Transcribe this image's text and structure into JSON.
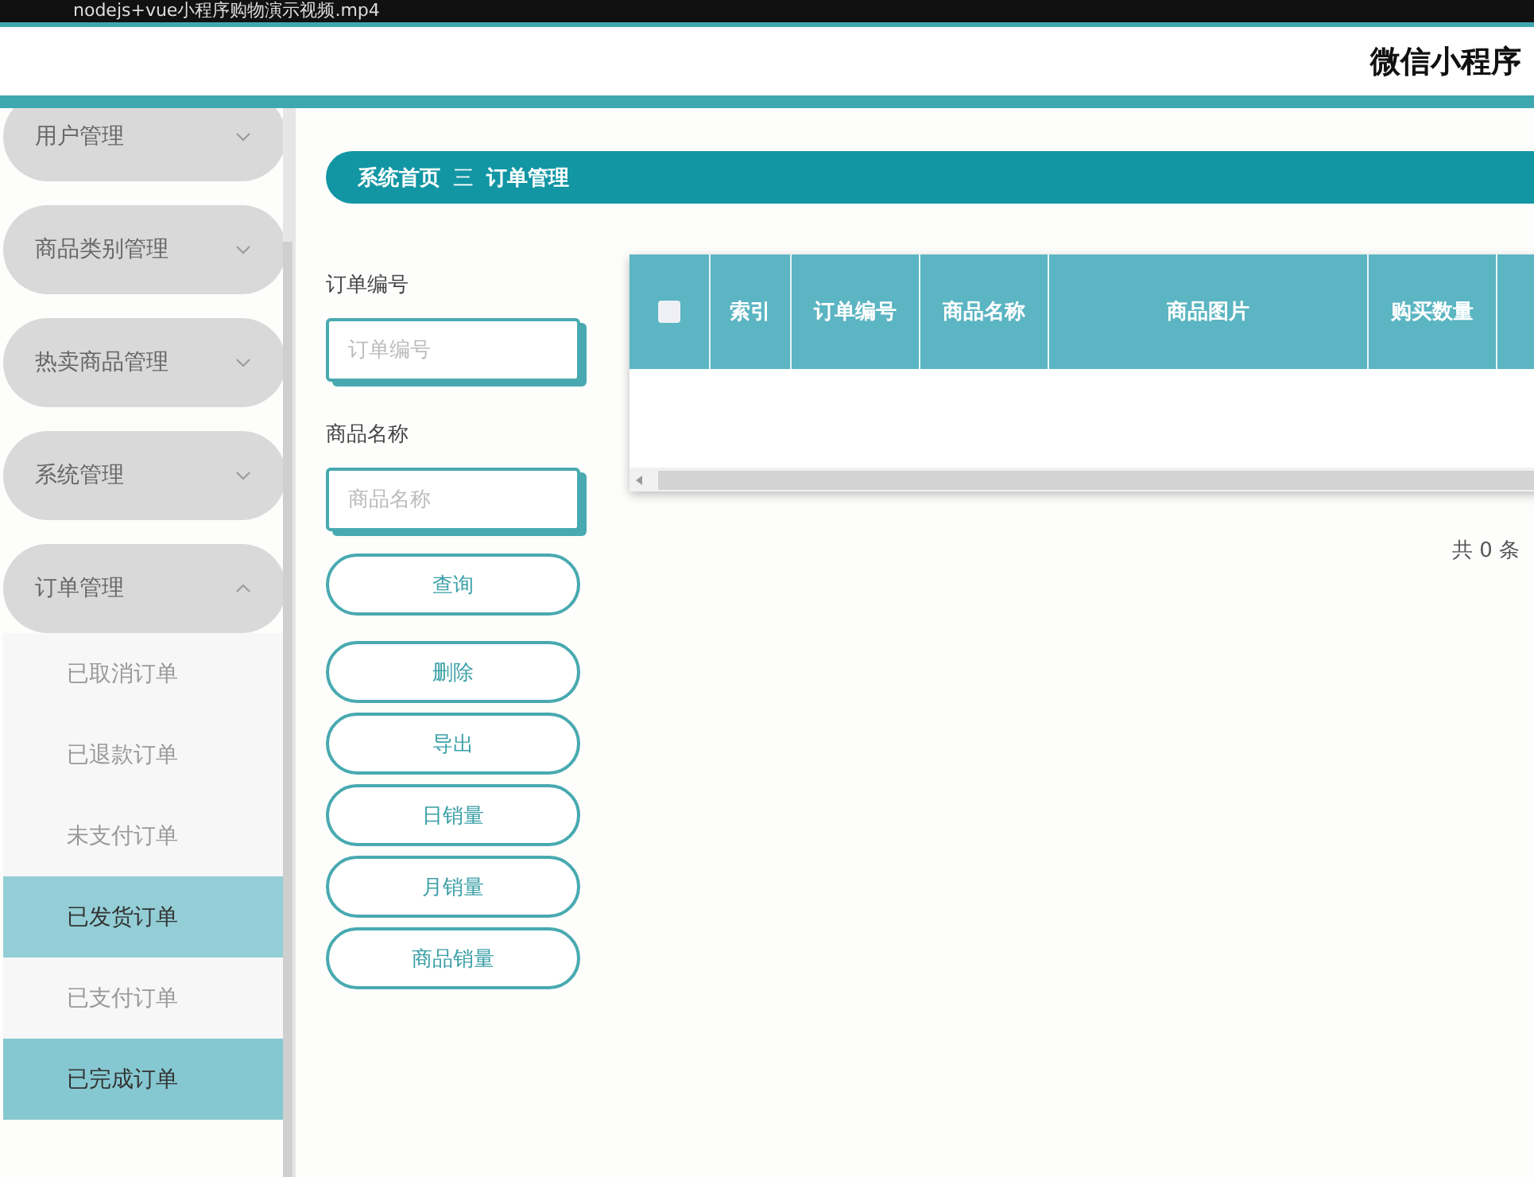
{
  "video_bar": {
    "title": "nodejs+vue小程序购物演示视频.mp4"
  },
  "header": {
    "title": "微信小程序"
  },
  "sidebar": {
    "items": [
      {
        "label": "用户管理",
        "expanded": false
      },
      {
        "label": "商品类别管理",
        "expanded": false
      },
      {
        "label": "热卖商品管理",
        "expanded": false
      },
      {
        "label": "系统管理",
        "expanded": false
      },
      {
        "label": "订单管理",
        "expanded": true,
        "children": [
          {
            "label": "已取消订单",
            "selected": false,
            "hovered": false
          },
          {
            "label": "已退款订单",
            "selected": false,
            "hovered": false
          },
          {
            "label": "未支付订单",
            "selected": false,
            "hovered": false
          },
          {
            "label": "已发货订单",
            "selected": true,
            "hovered": false
          },
          {
            "label": "已支付订单",
            "selected": false,
            "hovered": false
          },
          {
            "label": "已完成订单",
            "selected": false,
            "hovered": true
          }
        ]
      }
    ]
  },
  "breadcrumb": {
    "items": [
      "系统首页",
      "订单管理"
    ],
    "separator": "三"
  },
  "search": {
    "fields": [
      {
        "label": "订单编号",
        "placeholder": "订单编号"
      },
      {
        "label": "商品名称",
        "placeholder": "商品名称"
      }
    ],
    "buttons": [
      "查询",
      "删除",
      "导出",
      "日销量",
      "月销量",
      "商品销量"
    ]
  },
  "table": {
    "select_all_checked": false,
    "columns": [
      "索引",
      "订单编号",
      "商品名称",
      "商品图片",
      "购买数量",
      ""
    ]
  },
  "pagination": {
    "total": "共 0 条"
  }
}
